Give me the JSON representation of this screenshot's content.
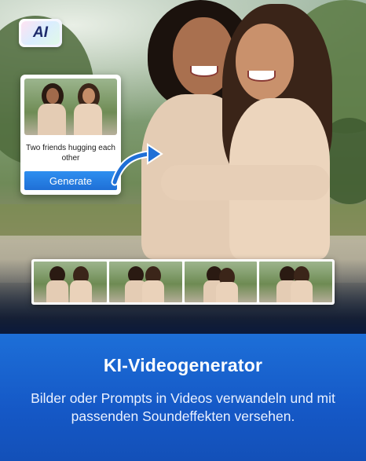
{
  "badge": {
    "label": "AI"
  },
  "prompt_card": {
    "prompt_text": "Two friends hugging each other",
    "generate_label": "Generate"
  },
  "filmstrip": {
    "frame_count": 4
  },
  "info": {
    "title": "KI-Videogenerator",
    "description": "Bilder oder Prompts in Videos verwandeln und mit passenden Soundeffekten versehen."
  },
  "colors": {
    "accent_blue": "#1f6fd6",
    "panel_blue": "#1558c6",
    "text_white": "#ffffff"
  },
  "icons": [
    "ai-badge-icon",
    "curved-arrow-icon"
  ]
}
